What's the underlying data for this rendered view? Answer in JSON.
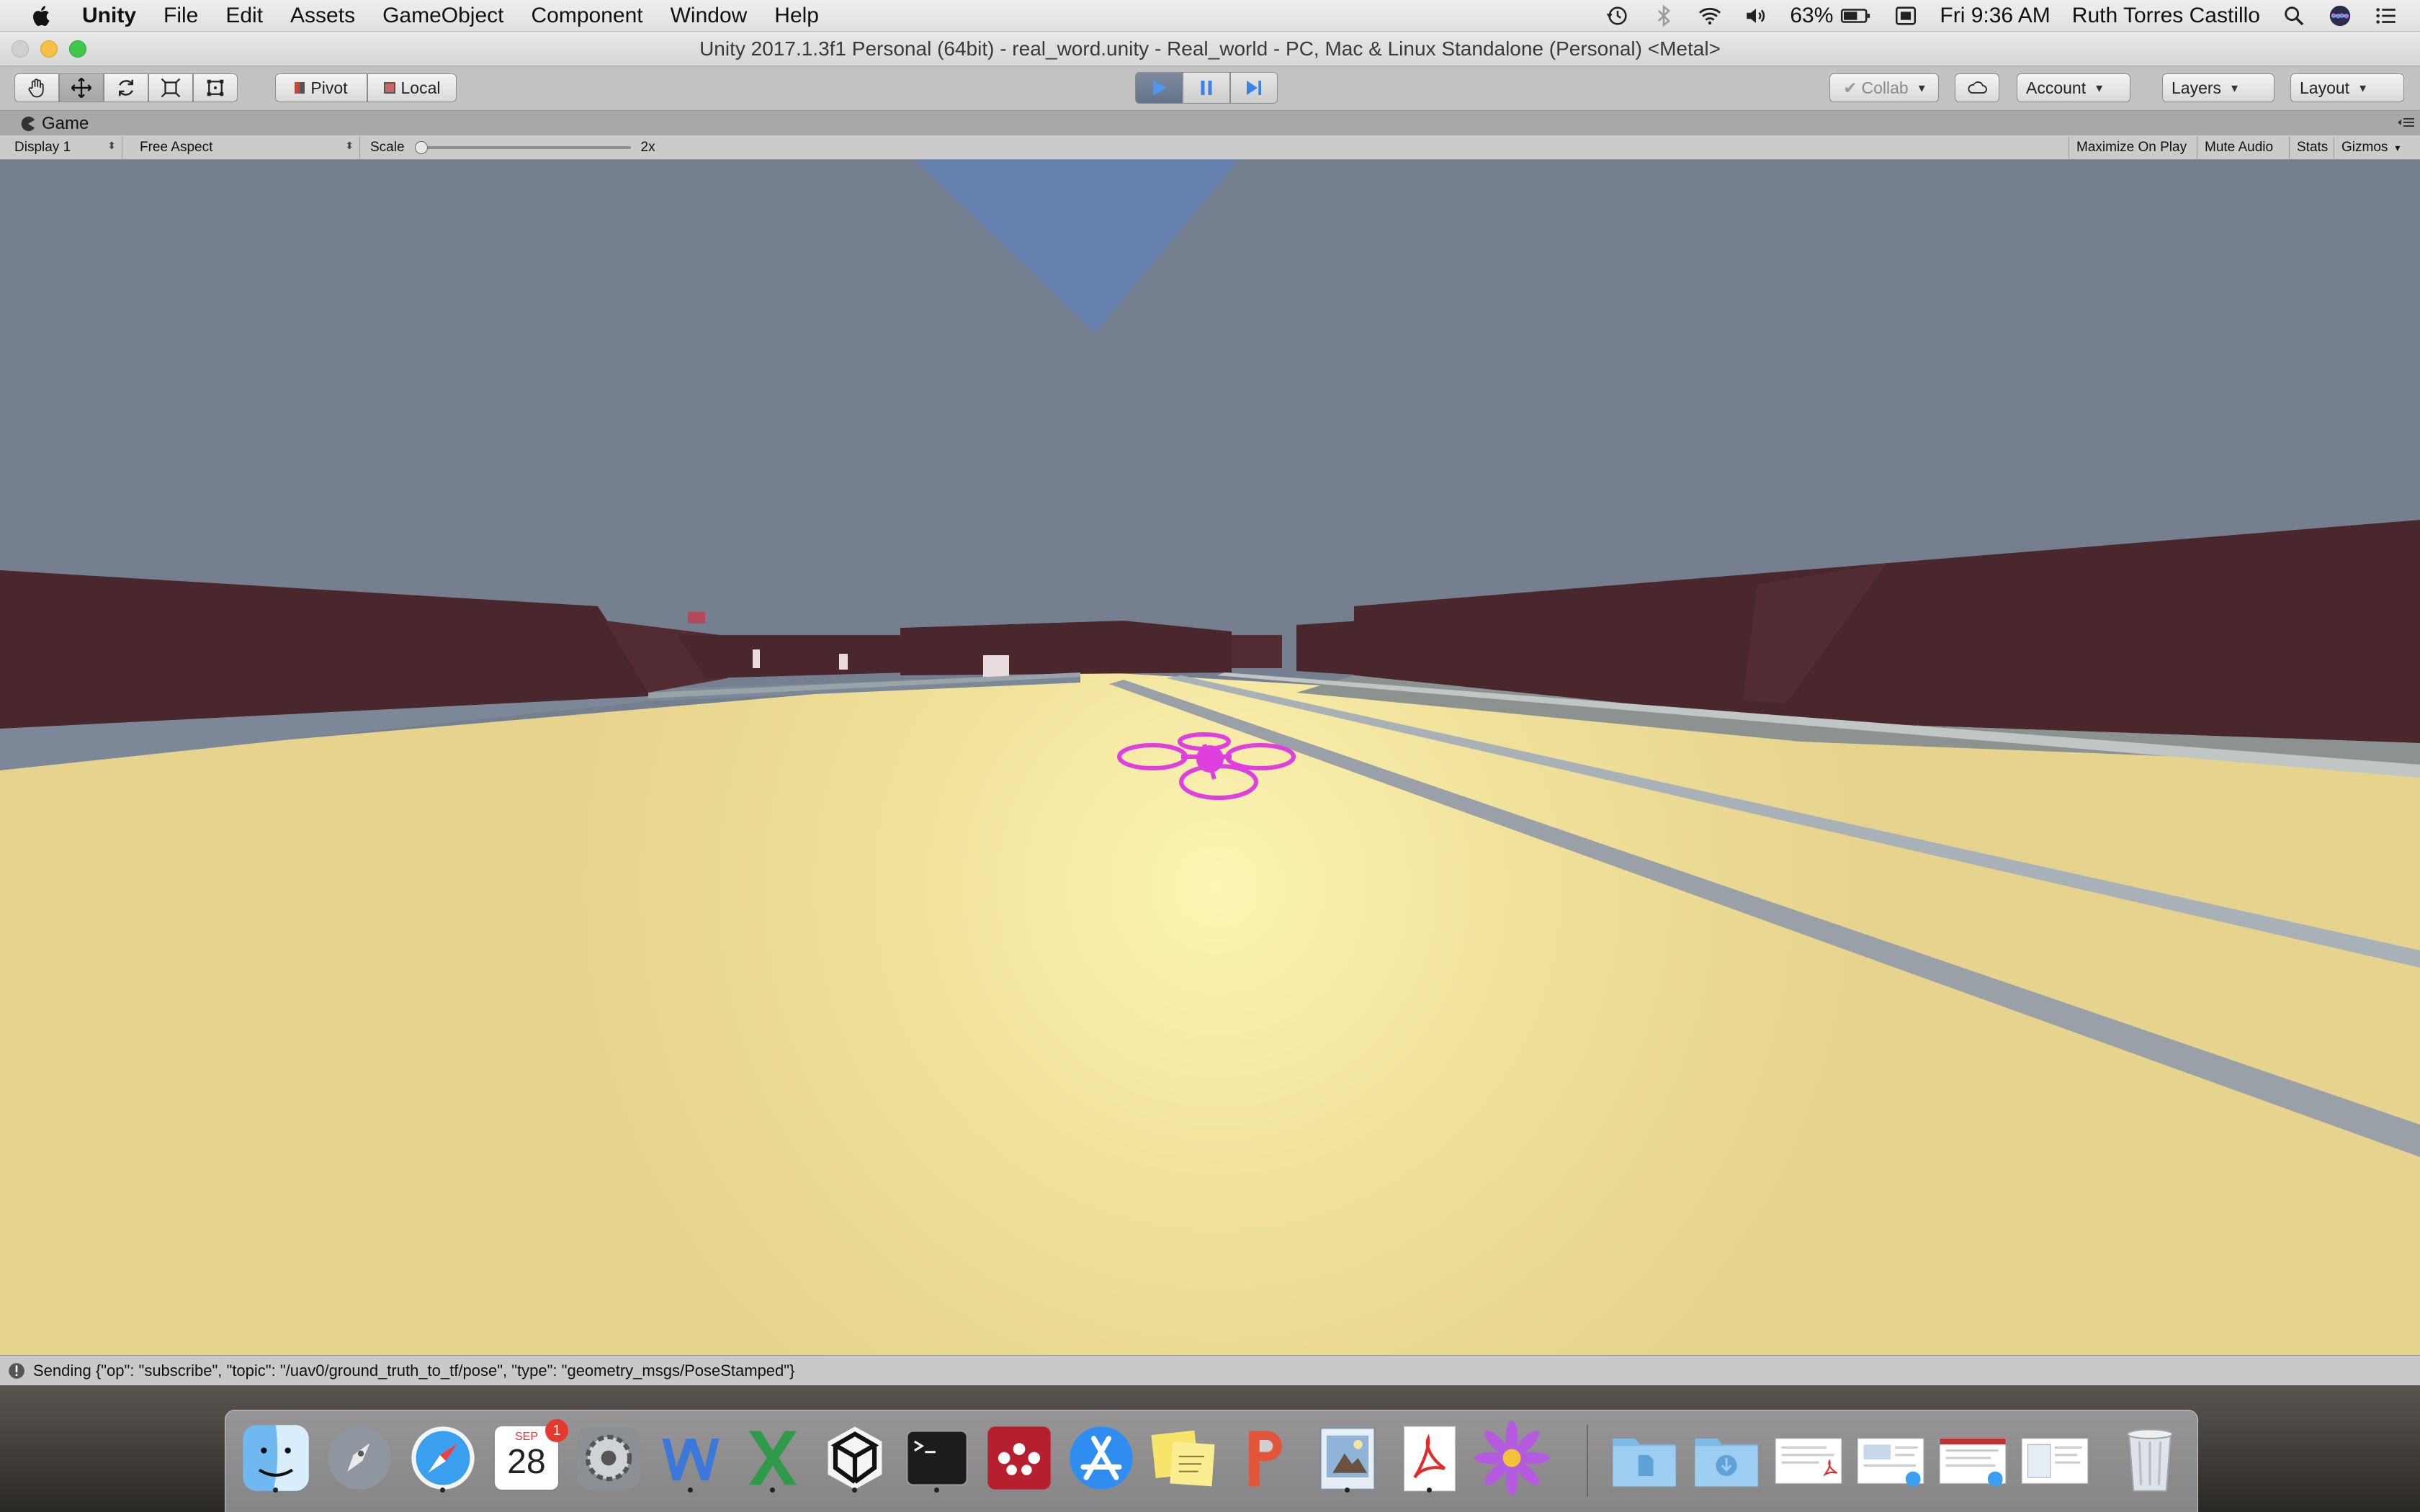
{
  "menubar": {
    "app_name": "Unity",
    "items": [
      "File",
      "Edit",
      "Assets",
      "GameObject",
      "Component",
      "Window",
      "Help"
    ],
    "battery": "63%",
    "clock": "Fri 9:36 AM",
    "user": "Ruth Torres Castillo"
  },
  "window": {
    "title": "Unity 2017.1.3f1 Personal (64bit) - real_word.unity - Real_world - PC, Mac & Linux Standalone (Personal) <Metal>"
  },
  "toolbar": {
    "pivot_label": "Pivot",
    "local_label": "Local",
    "collab_label": "Collab",
    "account_label": "Account",
    "layers_label": "Layers",
    "layout_label": "Layout",
    "play_state": "playing"
  },
  "game_panel": {
    "tab_label": "Game",
    "display_label": "Display 1",
    "aspect_label": "Free Aspect",
    "scale_label": "Scale",
    "scale_value": "2x",
    "maximize_label": "Maximize On Play",
    "mute_label": "Mute Audio",
    "stats_label": "Stats",
    "gizmos_label": "Gizmos"
  },
  "status": {
    "message": "Sending {\"op\": \"subscribe\", \"topic\": \"/uav0/ground_truth_to_tf/pose\", \"type\": \"geometry_msgs/PoseStamped\"}"
  },
  "dock": {
    "calendar_month": "SEP",
    "calendar_day": "28",
    "calendar_badge": "1",
    "apps": [
      "finder",
      "launchpad",
      "safari",
      "calendar",
      "system-preferences",
      "word",
      "excel",
      "unity",
      "terminal",
      "mendeley",
      "app-store",
      "stickies",
      "powerpoint",
      "preview",
      "acrobat",
      "flower",
      "documents-folder",
      "downloads-folder",
      "doc-thumb-1",
      "doc-thumb-2",
      "doc-thumb-3",
      "doc-thumb-4",
      "trash"
    ]
  },
  "colors": {
    "drone": "#e03fe0",
    "ground": "#efdf9a",
    "sky": "#757f90",
    "walls": "#4a262d",
    "play_active": "#5a8fe0"
  }
}
